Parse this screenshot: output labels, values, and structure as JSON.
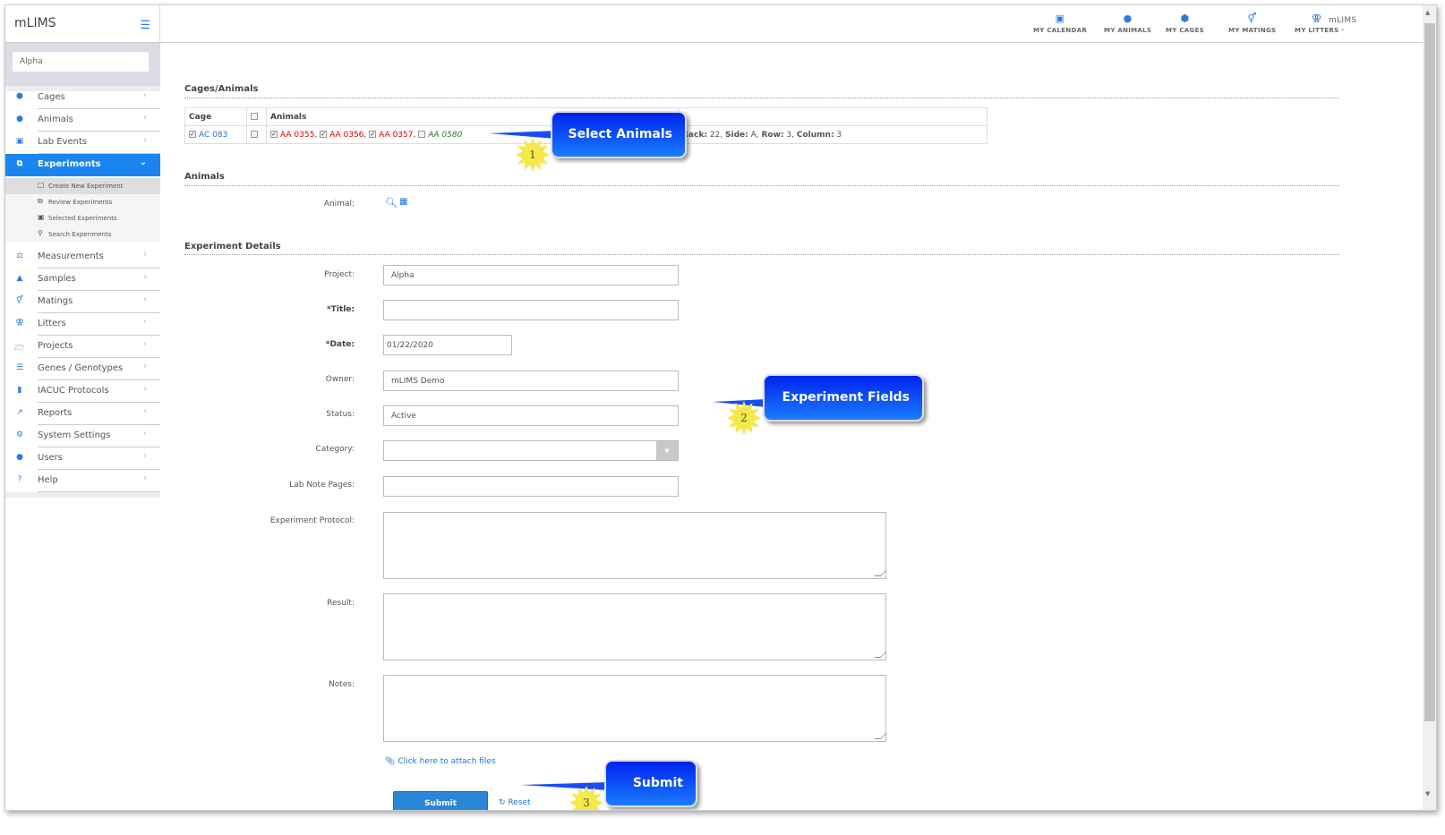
{
  "app": {
    "brand": "mLIMS",
    "sidebar_search_value": "Alpha",
    "user_menu": "mLIMS"
  },
  "topnav": [
    {
      "label": "MY CALENDAR",
      "icon": "calendar-icon"
    },
    {
      "label": "MY ANIMALS",
      "icon": "paw-icon"
    },
    {
      "label": "MY CAGES",
      "icon": "cube-icon"
    },
    {
      "label": "MY MATINGS",
      "icon": "mars-venus-icon"
    },
    {
      "label": "MY LITTERS",
      "icon": "venus-double-icon"
    }
  ],
  "sidebar": {
    "items": [
      {
        "label": "Cages",
        "icon": "cube-icon"
      },
      {
        "label": "Animals",
        "icon": "paw-icon"
      },
      {
        "label": "Lab Events",
        "icon": "calendar-icon"
      },
      {
        "label": "Experiments",
        "icon": "copy-icon",
        "active": true
      },
      {
        "label": "Measurements",
        "icon": "balance-icon"
      },
      {
        "label": "Samples",
        "icon": "flask-icon"
      },
      {
        "label": "Matings",
        "icon": "mars-venus-icon"
      },
      {
        "label": "Litters",
        "icon": "venus-double-icon"
      },
      {
        "label": "Projects",
        "icon": "folder-open-icon"
      },
      {
        "label": "Genes / Genotypes",
        "icon": "list-icon"
      },
      {
        "label": "IACUC Protocols",
        "icon": "book-icon"
      },
      {
        "label": "Reports",
        "icon": "line-chart-icon"
      },
      {
        "label": "System Settings",
        "icon": "gear-icon"
      },
      {
        "label": "Users",
        "icon": "users-icon"
      },
      {
        "label": "Help",
        "icon": "question-icon"
      }
    ],
    "subitems": [
      {
        "label": "Create New Experiment",
        "icon": "file-icon"
      },
      {
        "label": "Review Experiments",
        "icon": "copy-icon"
      },
      {
        "label": "Selected Experiments",
        "icon": "cart-icon"
      },
      {
        "label": "Search Experiments",
        "icon": "search-icon"
      }
    ]
  },
  "cages_section": {
    "title": "Cages/Animals",
    "headers": {
      "cage": "Cage",
      "animals": "Animals"
    },
    "row": {
      "cage": "AC 083",
      "animals": [
        {
          "id": "AA 0355",
          "checked": true
        },
        {
          "id": "AA 0356",
          "checked": true
        },
        {
          "id": "AA 0357",
          "checked": true
        },
        {
          "id": "AA 0580",
          "checked": false
        }
      ],
      "location": {
        "rack_label": "Rack:",
        "rack": "22",
        "side_label": "Side:",
        "side": "A",
        "row_label": "Row:",
        "row": "3",
        "col_label": "Column:",
        "col": "3"
      }
    }
  },
  "animals_section": {
    "title": "Animals",
    "animal_label": "Animal:"
  },
  "details": {
    "title": "Experiment Details",
    "project_label": "Project:",
    "project": "Alpha",
    "title_label": "*Title:",
    "title_value": "",
    "date_label": "*Date:",
    "date": "01/22/2020",
    "owner_label": "Owner:",
    "owner": "mLIMS Demo",
    "status_label": "Status:",
    "status": "Active",
    "category_label": "Category:",
    "category": "",
    "labnote_label": "Lab Note Pages:",
    "labnote": "",
    "protocol_label": "Experiment Protocol:",
    "result_label": "Result:",
    "notes_label": "Notes:",
    "attach": "Click here to attach files",
    "submit": "Submit",
    "reset": "Reset"
  },
  "callouts": [
    {
      "num": "1",
      "text": "Select Animals"
    },
    {
      "num": "2",
      "text": "Experiment Fields"
    },
    {
      "num": "3",
      "text": "Submit"
    }
  ]
}
